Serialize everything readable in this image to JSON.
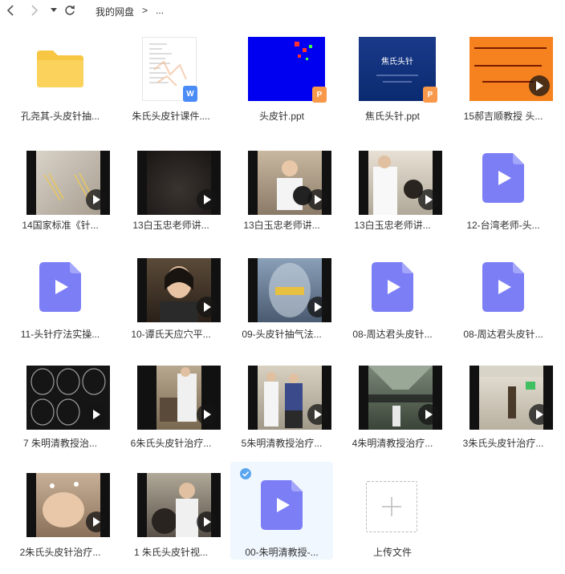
{
  "toolbar": {
    "back_icon": "‹",
    "forward_icon": "›",
    "dropdown_icon": "▾",
    "refresh_icon": "↻"
  },
  "breadcrumb": {
    "root": "我的网盘",
    "separator": ">",
    "more": "..."
  },
  "colors": {
    "accent": "#5aa6f0",
    "folder": "#f7c744",
    "video_file": "#7c7ef6",
    "word_badge": "#4a8bf5",
    "ppt_badge": "#f7984a",
    "selected_bg": "#f1f7fe"
  },
  "files": [
    {
      "name": "孔尧其-头皮针抽...",
      "kind": "folder"
    },
    {
      "name": "朱氏头皮针课件....",
      "kind": "word-doc",
      "badge": "W"
    },
    {
      "name": "头皮针.ppt",
      "kind": "ppt",
      "badge": "P"
    },
    {
      "name": "焦氏头针.ppt",
      "kind": "ppt",
      "badge": "P",
      "slide_title": "焦氏头针"
    },
    {
      "name": "15郝吉顺教授 头...",
      "kind": "video-thumb"
    },
    {
      "name": "14国家标准《针...",
      "kind": "video-thumb"
    },
    {
      "name": "13白玉忠老师讲...",
      "kind": "video-thumb"
    },
    {
      "name": "13白玉忠老师讲...",
      "kind": "video-thumb"
    },
    {
      "name": "13白玉忠老师讲...",
      "kind": "video-thumb"
    },
    {
      "name": "12-台湾老师-头...",
      "kind": "video-file"
    },
    {
      "name": "11-头针疗法实操...",
      "kind": "video-file"
    },
    {
      "name": "10-谭氏天应穴平...",
      "kind": "video-thumb"
    },
    {
      "name": "09-头皮针抽气法...",
      "kind": "video-thumb"
    },
    {
      "name": "08-周达君头皮针...",
      "kind": "video-file"
    },
    {
      "name": "08-周达君头皮针...",
      "kind": "video-file"
    },
    {
      "name": "7 朱明清教授治...",
      "kind": "video-thumb"
    },
    {
      "name": "6朱氏头皮针治疗...",
      "kind": "video-thumb"
    },
    {
      "name": "5朱明清教授治疗...",
      "kind": "video-thumb"
    },
    {
      "name": "4朱明清教授治疗...",
      "kind": "video-thumb"
    },
    {
      "name": "3朱氏头皮针治疗...",
      "kind": "video-thumb"
    },
    {
      "name": "2朱氏头皮针治疗...",
      "kind": "video-thumb"
    },
    {
      "name": "1 朱氏头皮针视...",
      "kind": "video-thumb"
    },
    {
      "name": "00-朱明清教授-...",
      "kind": "video-file",
      "selected": true
    }
  ],
  "upload": {
    "label": "上传文件",
    "icon": "plus-icon"
  }
}
